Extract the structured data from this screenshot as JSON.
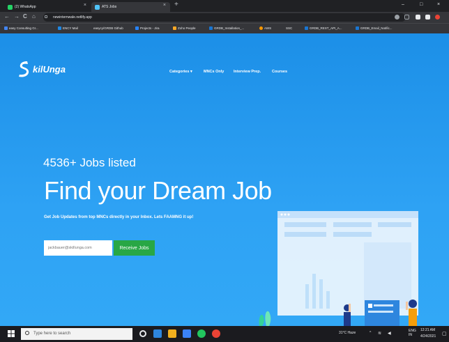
{
  "browser": {
    "tabs": [
      {
        "label": "(2) WhatsApp",
        "active": false
      },
      {
        "label": "ATS Jobs",
        "active": true
      }
    ],
    "new_tab": "+",
    "close_glyph": "×",
    "window_controls": {
      "minimize": "–",
      "maximize": "□",
      "close": "×"
    },
    "url": "newinternwale.netlify.app",
    "nav": {
      "back": "←",
      "forward": "→",
      "reload": "C",
      "home": "⌂"
    },
    "bookmarks": [
      "easy Consulting Gr...",
      "ENCY Mail",
      "easycy/GRDB Github",
      "Projects - Jira",
      "Zoho People",
      "GRDB_Installation_...",
      "AWS",
      "SSC",
      "GRDB_REST_API_A...",
      "GRDB_Email_Notific..."
    ]
  },
  "site": {
    "logo_text": "kilUnga",
    "menu": [
      "Categories ▾",
      "MNCs Only",
      "Interview Prep.",
      "Courses"
    ],
    "tagline": "4536+ Jobs listed",
    "headline": "Find your Dream Job",
    "subline": "Get Job Updates from top MNCs directly in your Inbox. Lets FAAMNG it up!",
    "email_placeholder": "jackbauer@skillunga.com",
    "cta": "Receive Jobs"
  },
  "taskbar": {
    "search_placeholder": "Type here to search",
    "weather": "31°C Haze",
    "language": "ENG IN",
    "time": "12:21 AM",
    "date": "4/24/2021"
  },
  "colors": {
    "hero": "#1f9bf0",
    "cta": "#28a745",
    "chrome_dark": "#202124"
  }
}
